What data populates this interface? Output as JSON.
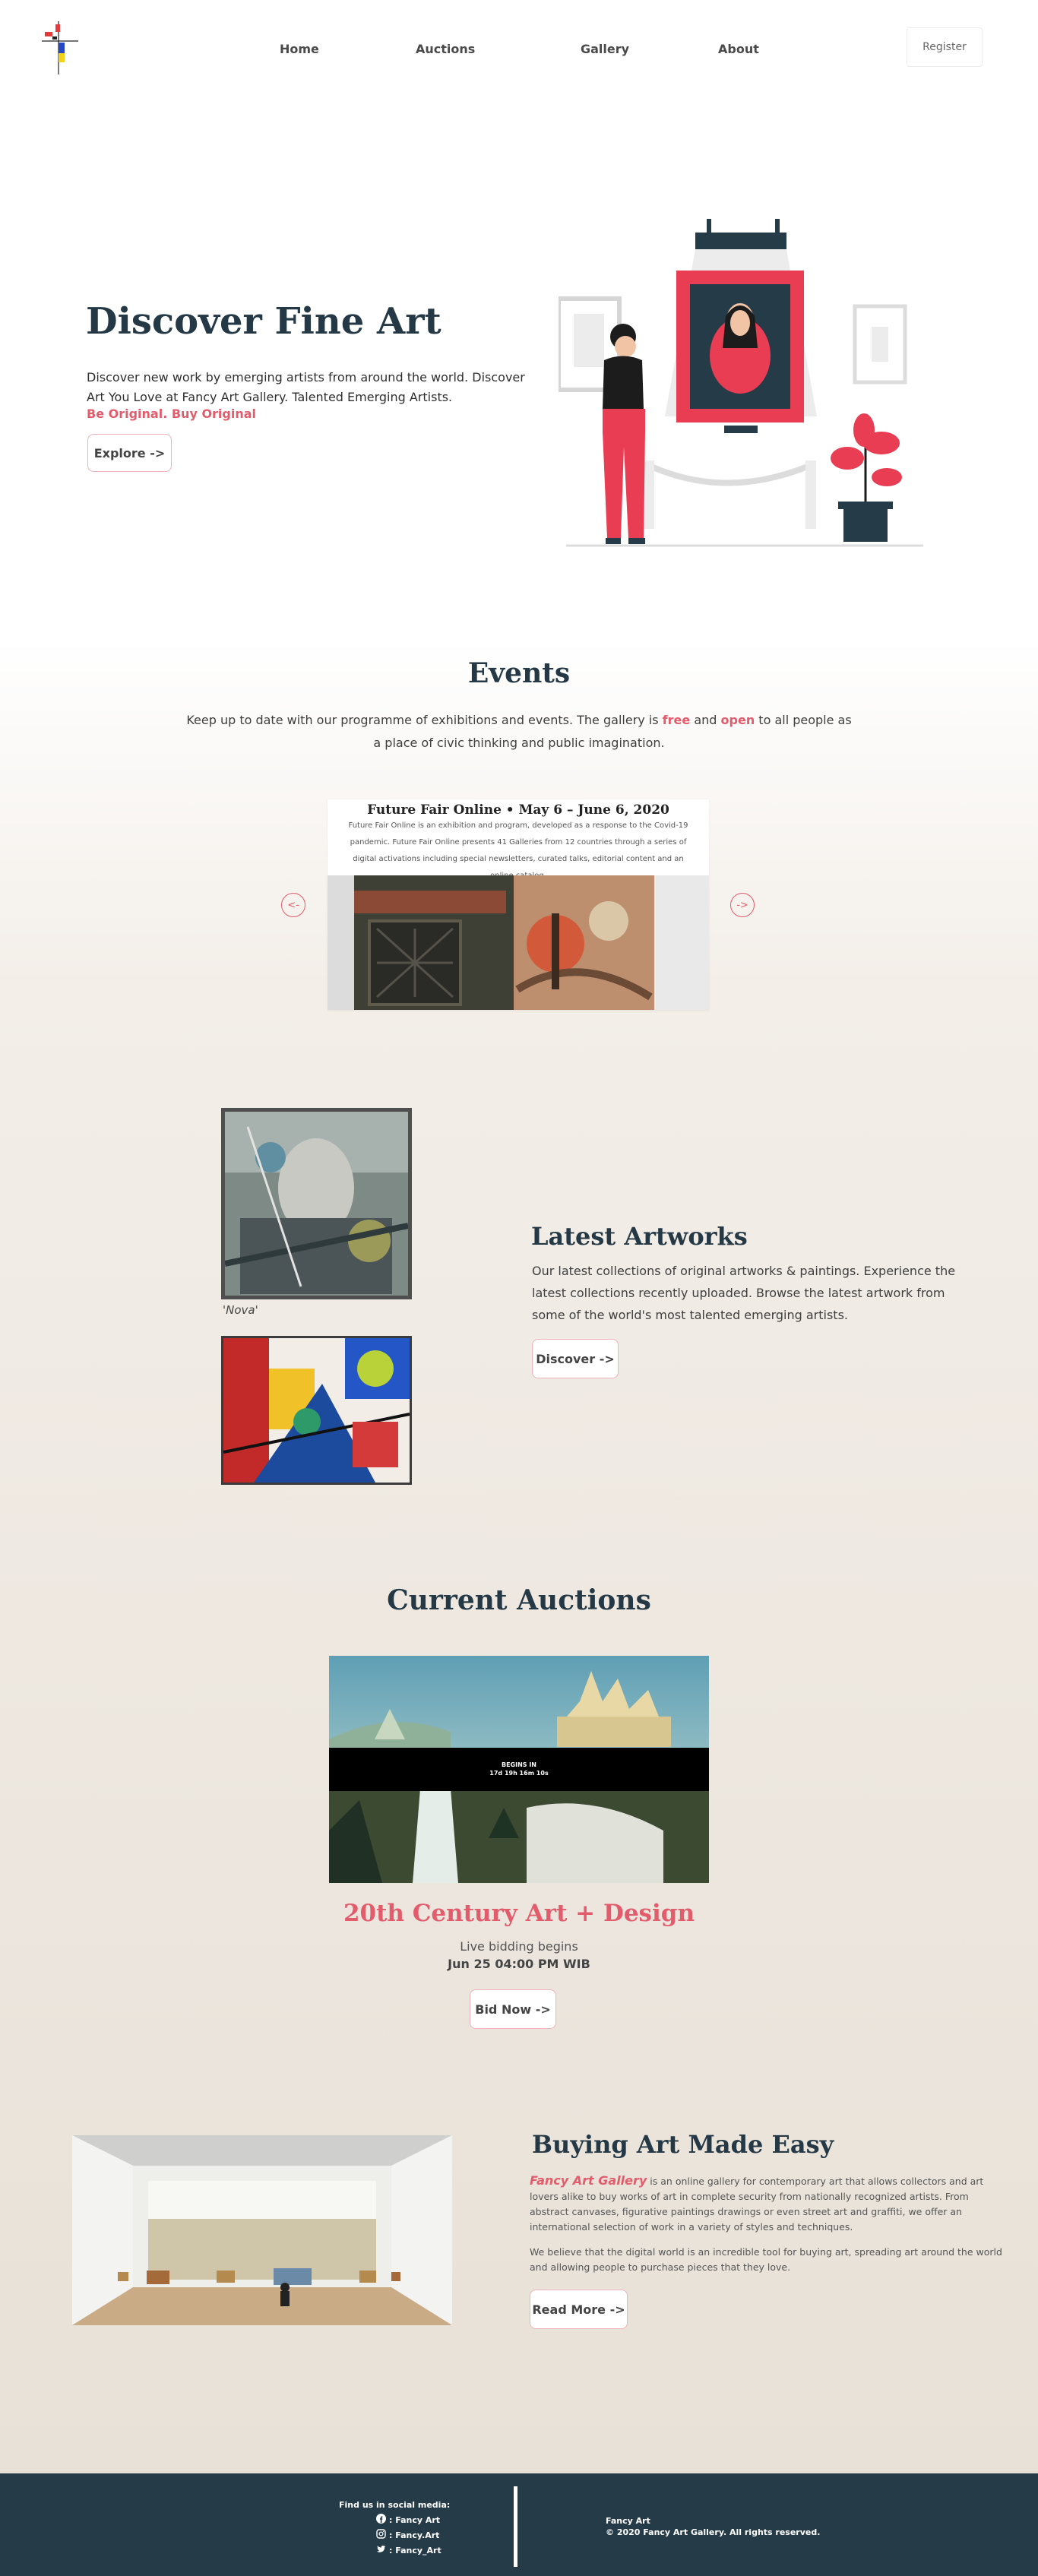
{
  "nav": {
    "links": [
      "Home",
      "Auctions",
      "Gallery",
      "About"
    ],
    "register": "Register"
  },
  "hero": {
    "title": "Discover Fine Art",
    "description": "Discover new work by emerging artists from around the world. Discover Art You Love at Fancy Art Gallery. Talented Emerging Artists.",
    "tagline": "Be Original. Buy Original",
    "button": "Explore ->"
  },
  "events": {
    "title": "Events",
    "desc_1": "Keep up to date with our programme of exhibitions and events. The gallery is ",
    "desc_free": "free",
    "desc_and": " and ",
    "desc_open": "open",
    "desc_2": " to all people as a place of civic thinking and public imagination.",
    "card_title": "Future Fair Online • May 6 – June 6, 2020",
    "card_text": "Future Fair Online is an exhibition and program, developed as a response to the Covid-19 pandemic. Future Fair Online presents 41 Galleries from 12 countries through a series of digital activations including special newsletters, curated talks, editorial content and an online catalog.",
    "prev": "<-",
    "next": "->"
  },
  "latest": {
    "title": "Latest Artworks",
    "description": "Our latest collections of original artworks & paintings. Experience the latest collections recently uploaded. Browse the latest artwork from some of the world's most talented emerging artists.",
    "button": "Discover ->",
    "artwork1_caption": "'Nova'"
  },
  "auctions": {
    "title": "Current Auctions",
    "countdown_label": "BEGINS IN",
    "countdown_value": "17d 19h 16m 10s",
    "name": "20th Century Art + Design",
    "subtitle": "Live bidding begins",
    "date": "Jun 25 04:00 PM WIB",
    "button": "Bid Now ->"
  },
  "buying": {
    "title": "Buying Art Made Easy",
    "brand": "Fancy Art Gallery",
    "p1": " is an online gallery for contemporary art that allows collectors and art lovers alike to buy works of art in complete security from nationally recognized artists. From abstract canvases, figurative paintings drawings or even street art and graffiti, we offer an international selection of work in a variety of styles and techniques.",
    "p2": "We believe that the digital world is an incredible tool for buying art, spreading art around the world and allowing people to purchase pieces that they love.",
    "button": "Read More ->"
  },
  "footer": {
    "social_label": "Find us in social media:",
    "facebook": ": Fancy Art",
    "instagram": ": Fancy.Art",
    "twitter": ": Fancy_Art",
    "brand": "Fancy Art",
    "copyright": "© 2020 Fancy Art Gallery. All rights reserved."
  },
  "colors": {
    "accent": "#e35c6c",
    "heading": "#243845",
    "footer_bg": "#253b47"
  }
}
